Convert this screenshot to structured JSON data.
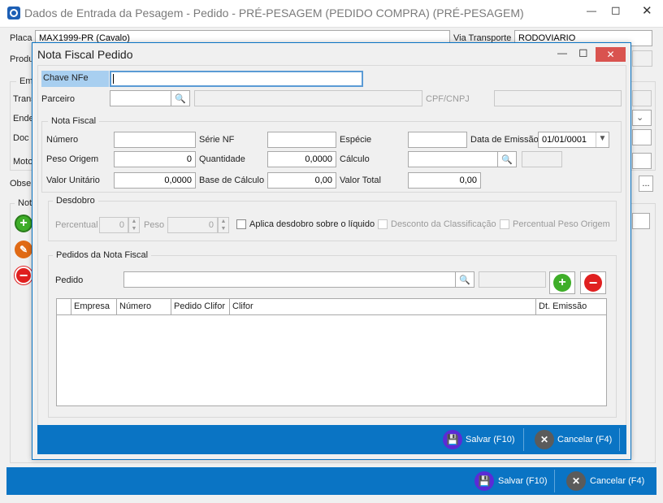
{
  "outer": {
    "title": "Dados de Entrada da Pesagem - Pedido - PRÉ-PESAGEM (PEDIDO COMPRA) (PRÉ-PESAGEM)",
    "placa_label": "Placa",
    "placa_value": "MAX1999-PR (Cavalo)",
    "via_transporte_label": "Via Transporte",
    "via_transporte_value": "RODOVIARIO",
    "produto_label": "Produ",
    "em_label": "Em",
    "trans_label": "Trans",
    "ende_label": "Ende",
    "doc_label": "Doc F",
    "moto_label": "Moto",
    "obse_label": "Obse",
    "not_label": "Not",
    "ellipsis": "...",
    "save_label": "Salvar (F10)",
    "cancel_label": "Cancelar (F4)"
  },
  "dialog": {
    "title": "Nota Fiscal Pedido",
    "chave_nfe_label": "Chave NFe",
    "chave_nfe_value": "",
    "parceiro_label": "Parceiro",
    "cpf_cnpj_label": "CPF/CNPJ",
    "nota_fiscal_group": "Nota Fiscal",
    "numero_label": "Número",
    "serie_nf_label": "Série NF",
    "especie_label": "Espécie",
    "data_emissao_label": "Data de Emissão",
    "data_emissao_value": "01/01/0001",
    "peso_origem_label": "Peso Origem",
    "peso_origem_value": "0",
    "quantidade_label": "Quantidade",
    "quantidade_value": "0,0000",
    "calculo_label": "Cálculo",
    "valor_unitario_label": "Valor Unitário",
    "valor_unitario_value": "0,0000",
    "base_calculo_label": "Base de Cálculo",
    "base_calculo_value": "0,00",
    "valor_total_label": "Valor Total",
    "valor_total_value": "0,00",
    "desdobro_group": "Desdobro",
    "percentual_label": "Percentual",
    "percentual_value": "0",
    "peso_label": "Peso",
    "peso_value": "0",
    "aplica_desdobro_label": "Aplica desdobro sobre o líquido",
    "desconto_classificacao_label": "Desconto da Classificação",
    "percentual_peso_origem_label": "Percentual Peso Origem",
    "pedidos_group": "Pedidos da Nota Fiscal",
    "pedido_label": "Pedido",
    "columns": [
      "Empresa",
      "Número",
      "Pedido Clifor",
      "Clifor",
      "Dt. Emissão"
    ],
    "save_label": "Salvar (F10)",
    "cancel_label": "Cancelar (F4)"
  },
  "colors": {
    "accent_bar": "#0a74c4",
    "save_icon": "#5b2bd6",
    "add_icon": "#3fae29",
    "remove_icon": "#e02020"
  }
}
